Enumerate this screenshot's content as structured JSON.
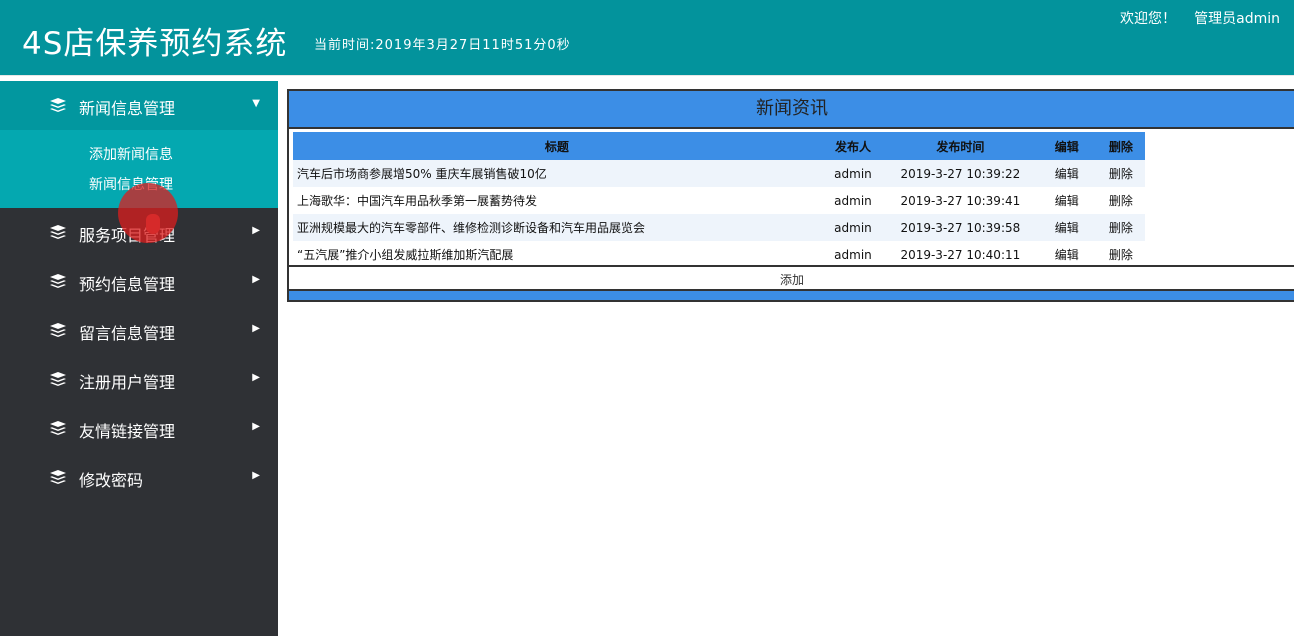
{
  "header": {
    "title": "4S店保养预约系统",
    "clock": "当前时间:2019年3月27日11时51分0秒",
    "welcome": "欢迎您！",
    "admin": "管理员admin"
  },
  "sidebar": {
    "groups": [
      {
        "label": "新闻信息管理",
        "icon": "layers-icon",
        "expanded": true,
        "items": [
          "添加新闻信息",
          "新闻信息管理"
        ]
      },
      {
        "label": "服务项目管理",
        "icon": "layers-icon"
      },
      {
        "label": "预约信息管理",
        "icon": "layers-icon"
      },
      {
        "label": "留言信息管理",
        "icon": "layers-icon"
      },
      {
        "label": "注册用户管理",
        "icon": "layers-icon"
      },
      {
        "label": "友情链接管理",
        "icon": "layers-icon"
      },
      {
        "label": "修改密码",
        "icon": "layers-icon"
      }
    ]
  },
  "main": {
    "panel_title": "新闻资讯",
    "columns": [
      "标题",
      "发布人",
      "发布时间",
      "编辑",
      "删除"
    ],
    "rows": [
      {
        "title": "汽车后市场商参展增50% 重庆车展销售破10亿",
        "author": "admin",
        "time": "2019-3-27 10:39:22",
        "edit": "编辑",
        "delete": "删除"
      },
      {
        "title": "上海歌华：中国汽车用品秋季第一展蓄势待发",
        "author": "admin",
        "time": "2019-3-27 10:39:41",
        "edit": "编辑",
        "delete": "删除"
      },
      {
        "title": "亚洲规模最大的汽车零部件、维修检测诊断设备和汽车用品展览会",
        "author": "admin",
        "time": "2019-3-27 10:39:58",
        "edit": "编辑",
        "delete": "删除"
      },
      {
        "title": "“五汽展”推介小组发威拉斯维加斯汽配展",
        "author": "admin",
        "time": "2019-3-27 10:40:11",
        "edit": "编辑",
        "delete": "删除"
      }
    ],
    "add_label": "添加"
  },
  "colors": {
    "header_bg": "#03939c",
    "sidebar_bg": "#2f3135",
    "submenu_bg": "#04a8b0",
    "table_header_bg": "#3c8ee6"
  }
}
